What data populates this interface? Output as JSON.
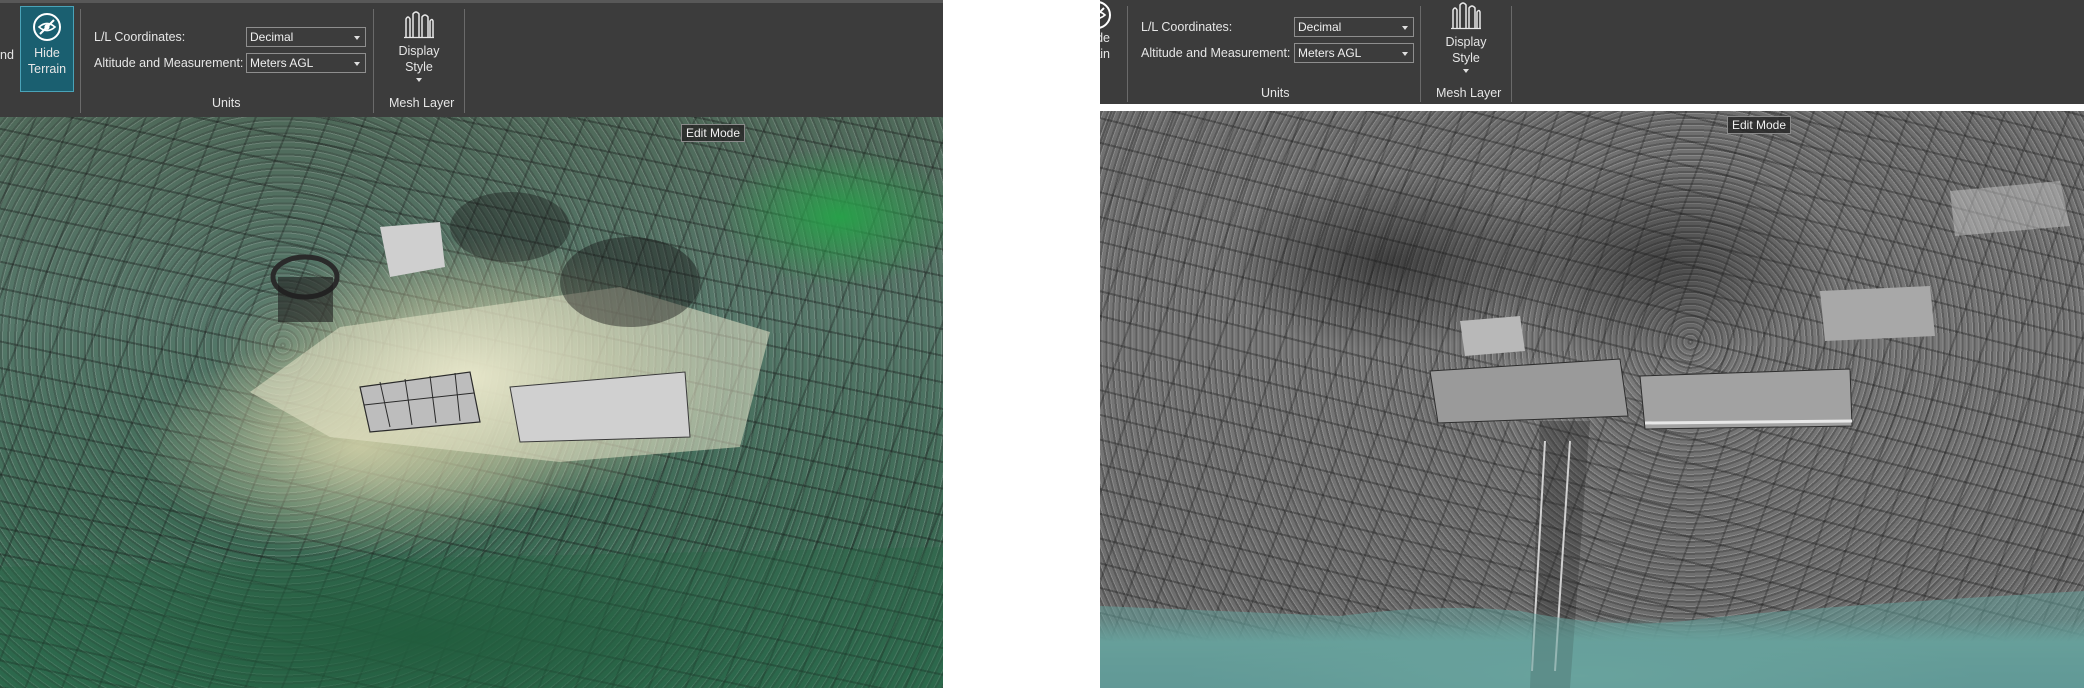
{
  "left": {
    "terrain_button": {
      "truncated_prev_label": "nd",
      "line1": "Hide",
      "line2": "Terrain"
    },
    "units": {
      "ll_label": "L/L Coordinates:",
      "ll_value": "Decimal",
      "alt_label": "Altitude and Measurement:",
      "alt_value": "Meters AGL",
      "group_label": "Units"
    },
    "display_style": {
      "line1": "Display",
      "line2": "Style",
      "group_label": "Mesh Layer"
    },
    "mode_label": "Edit Mode"
  },
  "right": {
    "terrain_button": {
      "line1": "de",
      "line2": "ain"
    },
    "units": {
      "ll_label": "L/L Coordinates:",
      "ll_value": "Decimal",
      "alt_label": "Altitude and Measurement:",
      "alt_value": "Meters AGL",
      "group_label": "Units"
    },
    "display_style": {
      "line1": "Display",
      "line2": "Style",
      "group_label": "Mesh Layer"
    },
    "mode_label": "Edit Mode"
  },
  "colors": {
    "ribbon_bg": "#3c3c3c",
    "hide_terrain_active": "#1a5f70",
    "mode_tag_bg": "#282828"
  }
}
